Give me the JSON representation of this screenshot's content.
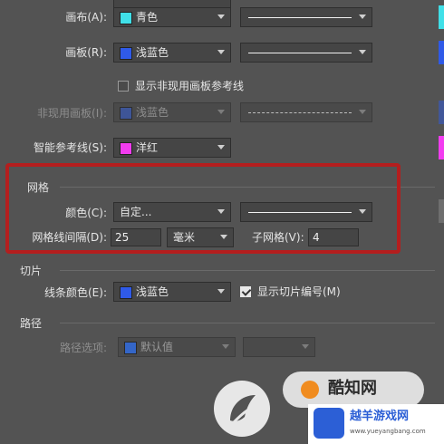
{
  "colors": {
    "panel_bg": "#535353",
    "cyan": "#40e0e8",
    "light_blue": "#2f5ae8",
    "magenta": "#f23cf0",
    "highlight_red": "#b41e1e",
    "watermark_blue": "#2c5fd6",
    "watermark_orange": "#f08c20"
  },
  "guides": {
    "canvas_label": "画布(A):",
    "canvas_color": "青色",
    "artboard_label": "画板(R):",
    "artboard_color": "浅蓝色",
    "show_inactive_label": "显示非现用画板参考线",
    "inactive_label": "非现用画板(I):",
    "inactive_color": "浅蓝色"
  },
  "smart_guides": {
    "label": "智能参考线(S):",
    "color": "洋红"
  },
  "grid": {
    "section_title": "网格",
    "color_label": "颜色(C):",
    "color_value": "自定...",
    "spacing_label": "网格线间隔(D):",
    "spacing_value": "25",
    "unit_value": "毫米",
    "subdivisions_label": "子网格(V):",
    "subdivisions_value": "4"
  },
  "slices": {
    "section_title": "切片",
    "line_color_label": "线条颜色(E):",
    "line_color_value": "浅蓝色",
    "show_numbers_label": "显示切片编号(M)"
  },
  "path": {
    "section_title": "路径",
    "options_label": "路径选项:",
    "options_value": "默认值"
  },
  "watermark": {
    "brand_cn": "酷知网",
    "site_cn": "越羊游戏网",
    "site_url": "www.yueyangbang.com"
  }
}
